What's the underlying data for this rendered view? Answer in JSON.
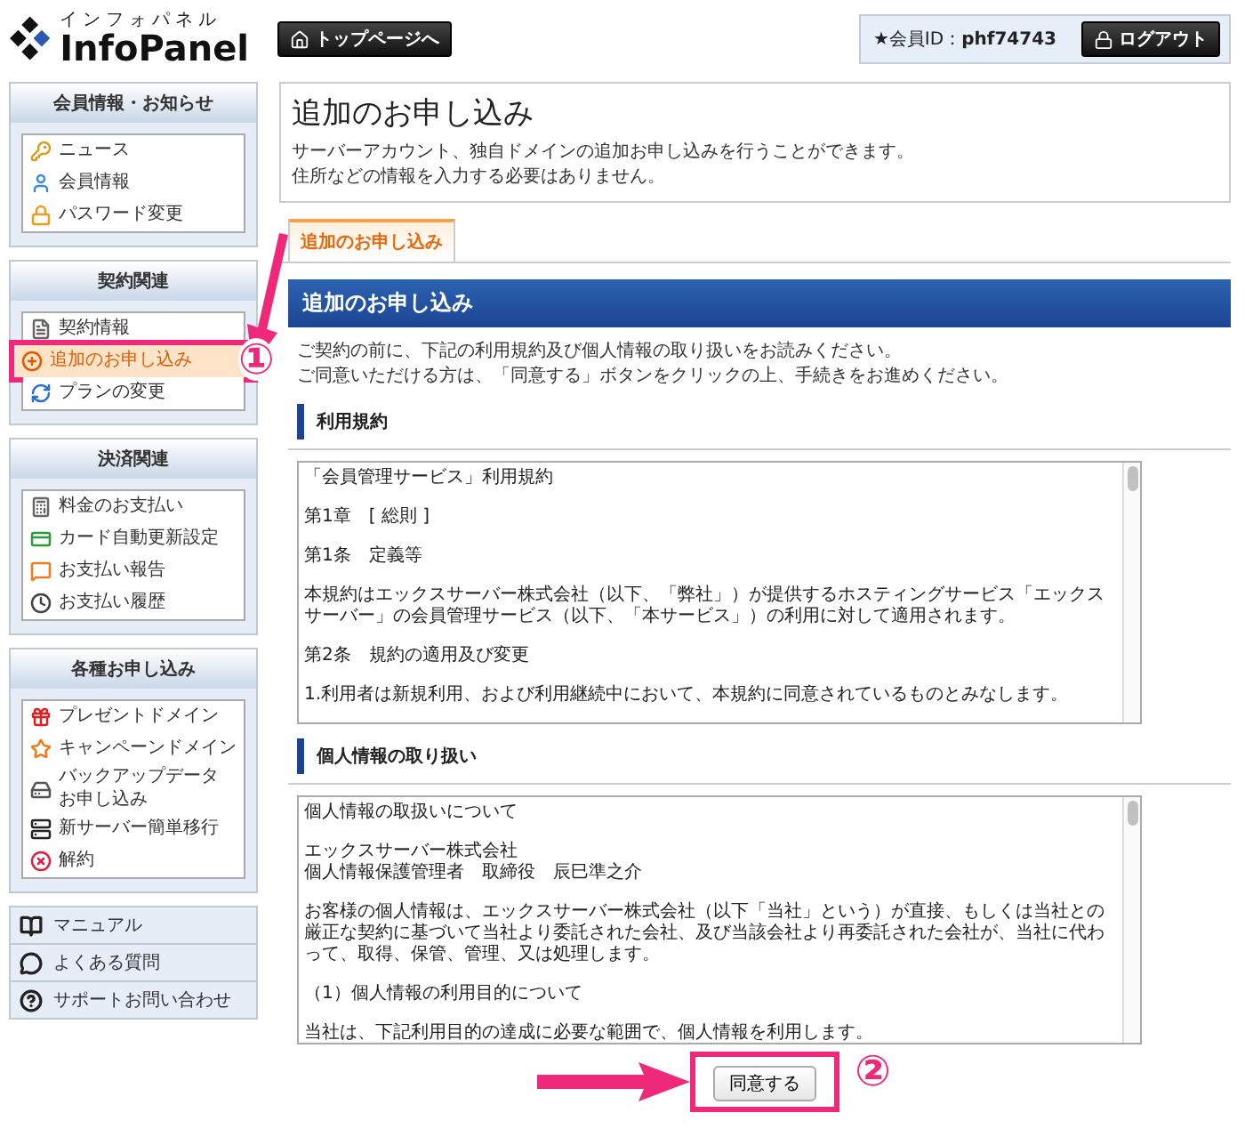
{
  "header": {
    "logo_kana": "インフォパネル",
    "logo_text": "InfoPanel",
    "top_button": "トップページへ",
    "member_id": "★会員ID：**phf74743**",
    "logout_button": "ログアウト"
  },
  "sidebar": {
    "groups": [
      {
        "title": "会員情報・お知らせ",
        "items": [
          {
            "label": "ニュース",
            "selected": false,
            "highlighted": false
          },
          {
            "label": "会員情報",
            "selected": false,
            "highlighted": false
          },
          {
            "label": "パスワード変更",
            "selected": false,
            "highlighted": false
          }
        ]
      },
      {
        "title": "契約関連",
        "items": [
          {
            "label": "契約情報",
            "selected": false,
            "highlighted": false
          },
          {
            "label": "追加のお申し込み",
            "selected": true,
            "highlighted": true
          },
          {
            "label": "プランの変更",
            "selected": false,
            "highlighted": false
          }
        ]
      },
      {
        "title": "決済関連",
        "items": [
          {
            "label": "料金のお支払い",
            "selected": false,
            "highlighted": false
          },
          {
            "label": "カード自動更新設定",
            "selected": false,
            "highlighted": false
          },
          {
            "label": "お支払い報告",
            "selected": false,
            "highlighted": false
          },
          {
            "label": "お支払い履歴",
            "selected": false,
            "highlighted": false
          }
        ]
      },
      {
        "title": "各種お申し込み",
        "items": [
          {
            "label": "プレゼントドメイン",
            "selected": false,
            "highlighted": false
          },
          {
            "label": "キャンペーンドメイン",
            "selected": false,
            "highlighted": false
          },
          {
            "lines": [
              "バックアップデータ",
              "お申し込み"
            ],
            "selected": false,
            "highlighted": false
          },
          {
            "label": "新サーバー簡単移行",
            "selected": false,
            "highlighted": false
          },
          {
            "label": "解約",
            "selected": false,
            "highlighted": false
          }
        ]
      }
    ],
    "links": [
      {
        "label": "マニュアル"
      },
      {
        "label": "よくある質問"
      },
      {
        "label": "サポートお問い合わせ"
      }
    ]
  },
  "page": {
    "title": "追加のお申し込み",
    "description": [
      "サーバーアカウント、独自ドメインの追加お申し込みを行うことができます。",
      "住所などの情報を入力する必要はありません。"
    ],
    "tabs": [
      {
        "label": "追加のお申し込み",
        "selected": true
      }
    ],
    "banner": "追加のお申し込み",
    "intro": [
      "ご契約の前に、下記の利用規約及び個人情報の取り扱いをお読みください。",
      "ご同意いただける方は、「同意する」ボタンをクリックの上、手続きをお進めください。"
    ],
    "sections": [
      {
        "heading": "利用規約",
        "text": [
          "「会員管理サービス」利用規約",
          "第1章　[ 総則 ]",
          "第1条　定義等",
          "本規約はエックスサーバー株式会社（以下、「弊社」）が提供するホスティングサービス「エックスサーバー」の会員管理サービス（以下、「本サービス」）の利用に対して適用されます。",
          "第2条　規約の適用及び変更",
          "1.利用者は新規利用、および利用継続中において、本規約に同意されているものとみなします。"
        ]
      },
      {
        "heading": "個人情報の取り扱い",
        "text": [
          "個人情報の取扱いについて",
          "エックスサーバー株式会社",
          "個人情報保護管理者　取締役　辰巳準之介",
          "お客様の個人情報は、エックスサーバー株式会社（以下「当社」という）が直接、もしくは当社との厳正な契約に基づいて当社より委託された会社、及び当該会社より再委託された会社が、当社に代わって、取得、保管、管理、又は処理します。",
          "（1）個人情報の利用目的について",
          "当社は、下記利用目的の達成に必要な範囲で、個人情報を利用します。"
        ]
      }
    ],
    "agree_button": "同意する"
  },
  "annotations": [
    {
      "marker": "①"
    },
    {
      "marker": "②"
    }
  ]
}
